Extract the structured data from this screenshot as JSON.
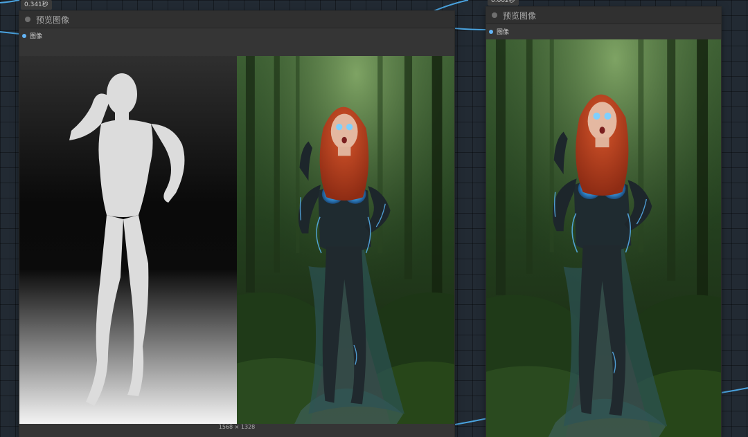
{
  "nodes": [
    {
      "title": "预览图像",
      "output_label": "图像",
      "time_badge": "0.341秒",
      "image_size": "1568 × 1328"
    },
    {
      "title": "预览图像",
      "output_label": "图像",
      "time_badge": "0.002秒"
    }
  ],
  "preview_images": {
    "depth_map": "pose-depth-map",
    "render": "red-haired-woman-in-forest"
  },
  "colors": {
    "canvas": "#222a33",
    "node_body": "#353535",
    "node_title": "#303030",
    "wire": "#4aa3df",
    "slot": "#64b5f6"
  }
}
